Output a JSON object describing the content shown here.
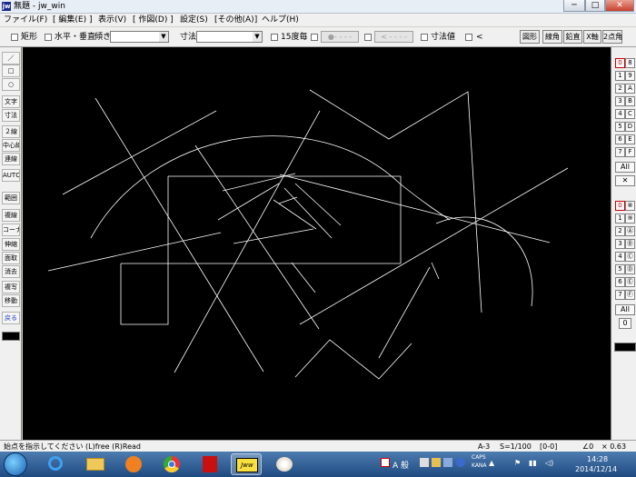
{
  "window": {
    "app_icon": "jw",
    "title": "無題 - jw_win",
    "controls": {
      "minimize": "─",
      "maximize": "□",
      "close": "✕"
    }
  },
  "menu": [
    "ファイル(F)",
    "[ 編集(E) ]",
    "表示(V)",
    "[ 作図(D) ]",
    "設定(S)",
    "[その他(A)]",
    "ヘルプ(H)"
  ],
  "toolbar": {
    "rect_label": "矩形",
    "hv_label": "水平・垂直",
    "slope_label": "傾き",
    "dim_label": "寸法",
    "deg15_label": "15度毎",
    "dots_label": "●- - - -",
    "arrow_label": "< - - - -",
    "dimvalue_label": "寸法値",
    "lt_label": "<",
    "right_buttons": [
      "図形",
      "線角",
      "鉛直",
      "X軸",
      "2点角"
    ]
  },
  "left_tools": [
    "／",
    "□",
    "○",
    "文字",
    "寸法",
    "２線",
    "中心線",
    "連線",
    "AUTO",
    "範囲",
    "複線",
    "コーナー",
    "伸縮",
    "面取",
    "消去",
    "複写",
    "移動",
    "戻る"
  ],
  "right_layers_top": {
    "left": [
      "0",
      "1",
      "2",
      "3",
      "4",
      "5",
      "6",
      "7"
    ],
    "right": [
      "8",
      "9",
      "A",
      "B",
      "C",
      "D",
      "E",
      "F"
    ],
    "all": "All",
    "x": "✕"
  },
  "right_layers_bottom": {
    "left": [
      "0",
      "1",
      "2",
      "3",
      "4",
      "5",
      "6",
      "7"
    ],
    "right": [
      "⑧",
      "⑨",
      "Ⓐ",
      "Ⓑ",
      "Ⓒ",
      "Ⓓ",
      "Ⓔ",
      "Ⓕ"
    ],
    "all": "All",
    "zero": "0"
  },
  "status": {
    "message": "始点を指示してください (L)free (R)Read",
    "paper": "A-3",
    "scale": "S=1/100",
    "layer": "[0-0]",
    "angle": "∠0",
    "zoom": "× 0.63"
  },
  "taskbar": {
    "ime": "A 般",
    "clock_time": "14:28",
    "clock_date": "2014/12/14",
    "caps": "CAPS",
    "kana": "KANA"
  },
  "colors": {
    "canvas": "#000000",
    "lines": "#ffffff",
    "accent_red": "#cc0000",
    "taskbar": "#2a5a90"
  }
}
